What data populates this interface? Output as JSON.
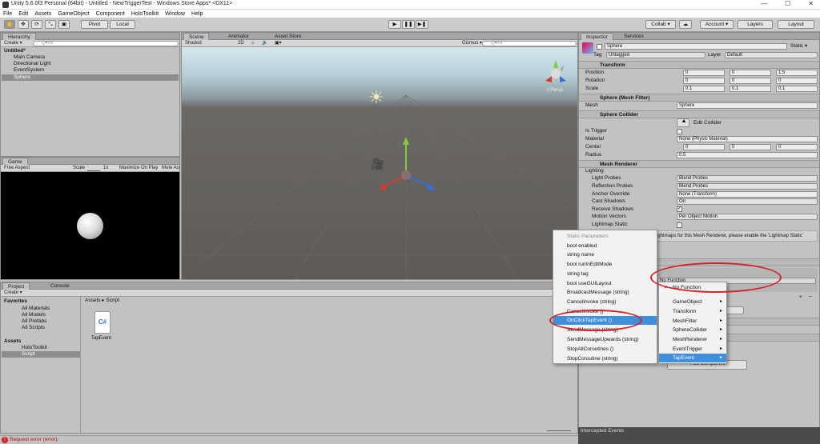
{
  "window": {
    "title": "Unity 5.6.0f3 Personal (64bit) - Untitled - NewTriggerTest - Windows Store Apps* <DX11>",
    "min": "—",
    "max": "☐",
    "close": "✕"
  },
  "menu": [
    "File",
    "Edit",
    "Assets",
    "GameObject",
    "Component",
    "HoloToolkit",
    "Window",
    "Help"
  ],
  "toolbar": {
    "pivot": "Pivot",
    "local": "Local",
    "collab": "Collab ▾",
    "account": "Account ▾",
    "layers": "Layers",
    "layout": "Layout",
    "play": "▶",
    "pause": "❚❚",
    "step": "▶❚"
  },
  "hierarchy": {
    "tab": "Hierarchy",
    "create": "Create ▾",
    "search": "Q▾All",
    "scene": "Untitled*",
    "items": [
      "Main Camera",
      "Directional Light",
      "EventSystem",
      "Sphere"
    ]
  },
  "scene": {
    "tabs": [
      "Scene",
      "Animator",
      "Asset Store"
    ],
    "shaded": "Shaded",
    "mode2d": "2D",
    "gizmos": "Gizmos ▾",
    "search": "Q▾All",
    "persp": "◁ Persp"
  },
  "game": {
    "tab": "Game",
    "aspect": "Free Aspect",
    "scale_label": "Scale",
    "scale_val": "1x",
    "maximize": "Maximize On Play",
    "mute": "Mute Au"
  },
  "project": {
    "tabs": [
      "Project",
      "Console"
    ],
    "create": "Create ▾",
    "favorites": "Favorites",
    "fav_items": [
      "All Materials",
      "All Models",
      "All Prefabs",
      "All Scripts"
    ],
    "assets": "Assets",
    "asset_items": [
      "HoloToolkit",
      "Script"
    ],
    "breadcrumb": "Assets ▸ Script",
    "file": "TapEvent",
    "file_glyph": "C#"
  },
  "inspector": {
    "tabs": [
      "Inspector",
      "Services"
    ],
    "name": "Sphere",
    "static": "Static ▾",
    "tag_label": "Tag",
    "tag": "Untagged",
    "layer_label": "Layer",
    "layer": "Default",
    "transform": {
      "title": "Transform",
      "rows": [
        {
          "label": "Position",
          "x": "0",
          "y": "0",
          "z": "1.5"
        },
        {
          "label": "Rotation",
          "x": "0",
          "y": "0",
          "z": "0"
        },
        {
          "label": "Scale",
          "x": "0.1",
          "y": "0.1",
          "z": "0.1"
        }
      ]
    },
    "meshfilter": {
      "title": "Sphere (Mesh Filter)",
      "mesh_label": "Mesh",
      "mesh": "Sphere"
    },
    "collider": {
      "title": "Sphere Collider",
      "edit": "Edit Collider",
      "trigger": "Is Trigger",
      "material_label": "Material",
      "material": "None (Physic Material)",
      "center_label": "Center",
      "cx": "0",
      "cy": "0",
      "cz": "0",
      "radius_label": "Radius",
      "radius": "0.5"
    },
    "renderer": {
      "title": "Mesh Renderer",
      "lighting": "Lighting",
      "rows": [
        {
          "label": "Light Probes",
          "value": "Blend Probes"
        },
        {
          "label": "Reflection Probes",
          "value": "Blend Probes"
        },
        {
          "label": "Anchor Override",
          "value": "None (Transform)"
        },
        {
          "label": "Cast Shadows",
          "value": "On"
        },
        {
          "label": "Receive Shadows",
          "value": ""
        },
        {
          "label": "Motion Vectors",
          "value": "Per Object Motion"
        },
        {
          "label": "Lightmap Static",
          "value": ""
        }
      ],
      "note": "ightmaps for this Mesh Renderer, please enable the 'Lightmap Static'"
    },
    "nofunc": "No Function",
    "add_component": "Add Component",
    "plus": "+",
    "minus": "−"
  },
  "method_menu": [
    "Static Parameters",
    "bool enabled",
    "string name",
    "bool runInEditMode",
    "string tag",
    "bool useGUILayout",
    "BroadcastMessage (string)",
    "CancelInvoke (string)",
    "CancelInvoke ()",
    "OnClickTapEvent ()",
    "SendMessage (string)",
    "SendMessageUpwards (string)",
    "StopAllCoroutines ()",
    "StopCoroutine (string)"
  ],
  "component_menu": [
    "No Function",
    "GameObject",
    "Transform",
    "MeshFilter",
    "SphereCollider",
    "MeshRenderer",
    "EventTrigger",
    "TapEvent"
  ],
  "statusbar": {
    "error": "Request error (error):",
    "intercepted": "Intercepted Events"
  },
  "colors": {
    "highlight": "#3f8fda",
    "annotation": "#d3232a",
    "sky": "#c9dde6",
    "ground": "#5d5a57"
  }
}
